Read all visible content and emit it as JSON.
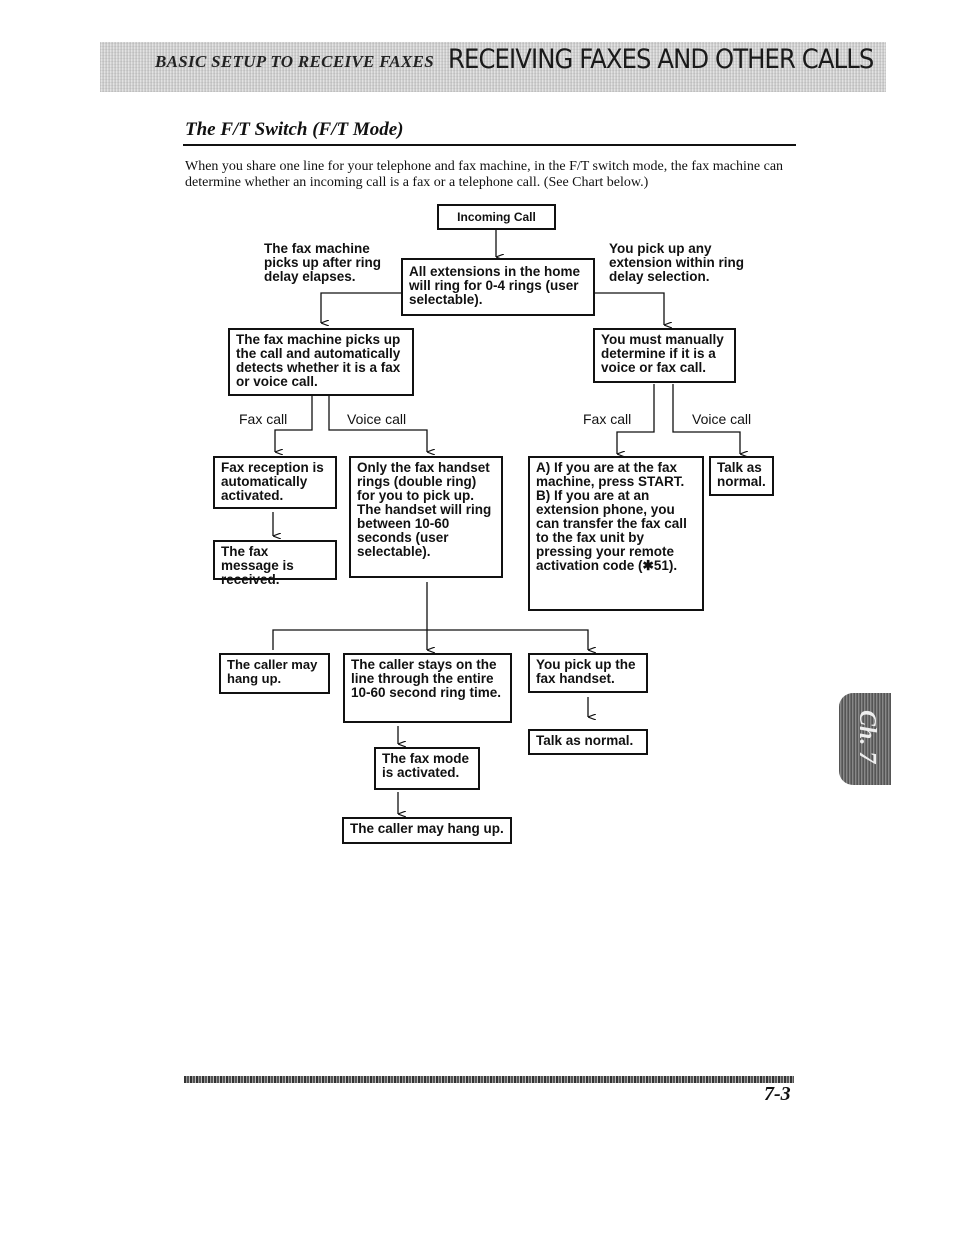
{
  "header": {
    "section": "BASIC SETUP TO RECEIVE FAXES",
    "chapter_title": "RECEIVING FAXES AND OTHER CALLS"
  },
  "page": {
    "title": "The F/T Switch (F/T Mode)",
    "intro": "When you share one line for your telephone and fax machine, in the F/T switch mode, the fax machine can determine whether an incoming call is a fax or a telephone call. (See Chart below.)",
    "chapter_tab": "Ch. 7",
    "page_number": "7-3"
  },
  "flowchart": {
    "incoming_call": "Incoming Call",
    "ring_all": "All extensions in the home will ring for 0-4 rings (user selectable).",
    "left_branch_label": "The fax machine picks up after ring delay elapses.",
    "right_branch_label": "You pick up any extension within ring delay selection.",
    "auto_detect": "The fax machine picks up the call and automatically detects whether it is a fax or voice call.",
    "manual_determine": "You must manually determine if it is a voice or fax call.",
    "fax_call": "Fax call",
    "voice_call": "Voice call",
    "fax_reception": "Fax reception is automatically activated.",
    "fax_received": "The fax message is received.",
    "handset_rings": "Only the fax handset rings (double ring) for you to pick up. The handset will ring between 10-60 seconds (user selectable).",
    "manual_fax_a_label": "A)",
    "manual_fax_a": "If you are at the fax machine, press START.",
    "manual_fax_b_label": "B)",
    "manual_fax_b": "If you are at an extension phone, you can transfer the fax call to the fax unit by pressing your remote activation code (✱51).",
    "talk_as_normal_short": "Talk as normal.",
    "caller_hangs_up": "The caller may hang up.",
    "caller_stays": "The caller stays on the line through the entire 10-60 second ring time.",
    "pick_up_handset": "You pick up the fax handset.",
    "talk_as_normal": "Talk as normal.",
    "fax_mode_activated": "The fax mode is activated.",
    "caller_may_hang_up": "The caller may hang up."
  }
}
